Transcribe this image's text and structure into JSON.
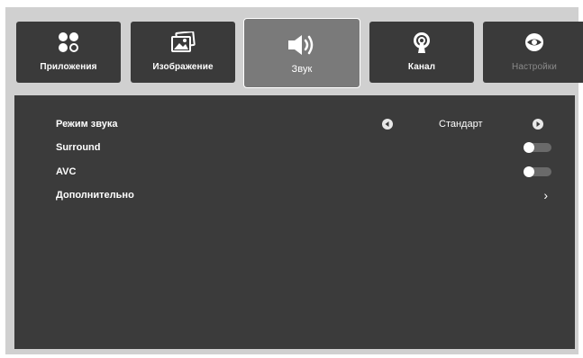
{
  "tabs": [
    {
      "label": "Приложения",
      "icon": "apps-icon"
    },
    {
      "label": "Изображение",
      "icon": "picture-icon"
    },
    {
      "label": "Звук",
      "icon": "speaker-icon"
    },
    {
      "label": "Канал",
      "icon": "antenna-icon"
    },
    {
      "label": "Настройки",
      "icon": "eye-icon"
    }
  ],
  "selected_tab": "Звук",
  "sound": {
    "mode": {
      "label": "Режим звука",
      "value": "Стандарт"
    },
    "surround": {
      "label": "Surround",
      "state": "off"
    },
    "avc": {
      "label": "AVC",
      "state": "off"
    },
    "advanced": {
      "label": "Дополнительно",
      "chevron": "›"
    }
  },
  "colors": {
    "tab_bg": "#3a3a3a",
    "tab_selected_bg": "#7a7a7a",
    "panel_bg": "#3b3b3b",
    "frame_bg": "#d0d0d0",
    "disabled_text": "#8a8a8a"
  }
}
